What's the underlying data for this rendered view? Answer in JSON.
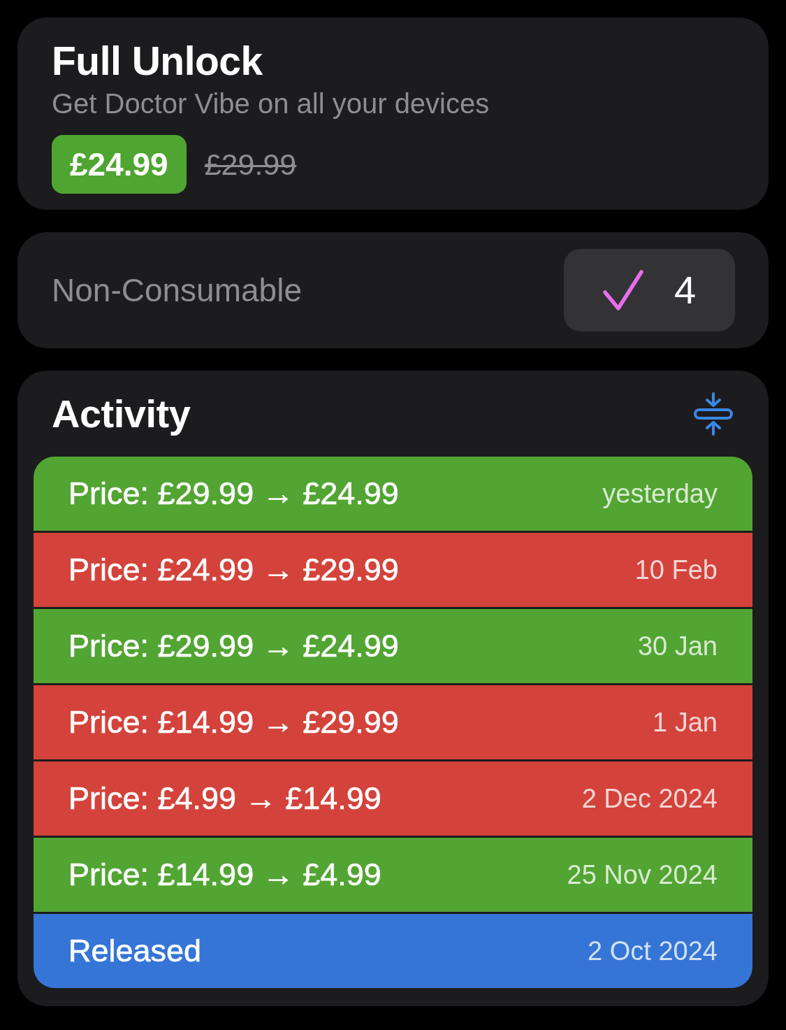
{
  "product": {
    "title": "Full Unlock",
    "subtitle": "Get Doctor Vibe on all your devices",
    "price": "£24.99",
    "original_price": "£29.99"
  },
  "type_card": {
    "label": "Non-Consumable",
    "count": "4"
  },
  "activity": {
    "title": "Activity",
    "events": [
      {
        "kind": "decrease",
        "text": "Price: £29.99 → £24.99",
        "date": "yesterday"
      },
      {
        "kind": "increase",
        "text": "Price: £24.99 → £29.99",
        "date": "10 Feb"
      },
      {
        "kind": "decrease",
        "text": "Price: £29.99 → £24.99",
        "date": "30 Jan"
      },
      {
        "kind": "increase",
        "text": "Price: £14.99 → £29.99",
        "date": "1 Jan"
      },
      {
        "kind": "increase",
        "text": "Price: £4.99 → £14.99",
        "date": "2 Dec 2024"
      },
      {
        "kind": "decrease",
        "text": "Price: £14.99 → £4.99",
        "date": "25 Nov 2024"
      },
      {
        "kind": "release",
        "text": "Released",
        "date": "2 Oct 2024"
      }
    ]
  }
}
